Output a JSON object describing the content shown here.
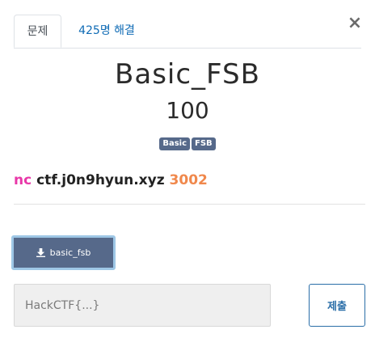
{
  "tabs": {
    "challenge_label": "문제",
    "solves_label": "425명 해결"
  },
  "close_symbol": "×",
  "challenge": {
    "name": "Basic_FSB",
    "value": "100",
    "tags": [
      "Basic",
      "FSB"
    ]
  },
  "description": {
    "prefix": "nc",
    "host": "ctf.j0n9hyun.xyz",
    "port": "3002"
  },
  "file": {
    "label": "basic_fsb",
    "icon": "download-icon"
  },
  "flag": {
    "placeholder": "HackCTF{...}",
    "value": ""
  },
  "submit_label": "제출",
  "colors": {
    "tag_bg": "#56698a",
    "nc": "#e838a8",
    "port": "#f0884c",
    "link": "#0f6bb5"
  }
}
